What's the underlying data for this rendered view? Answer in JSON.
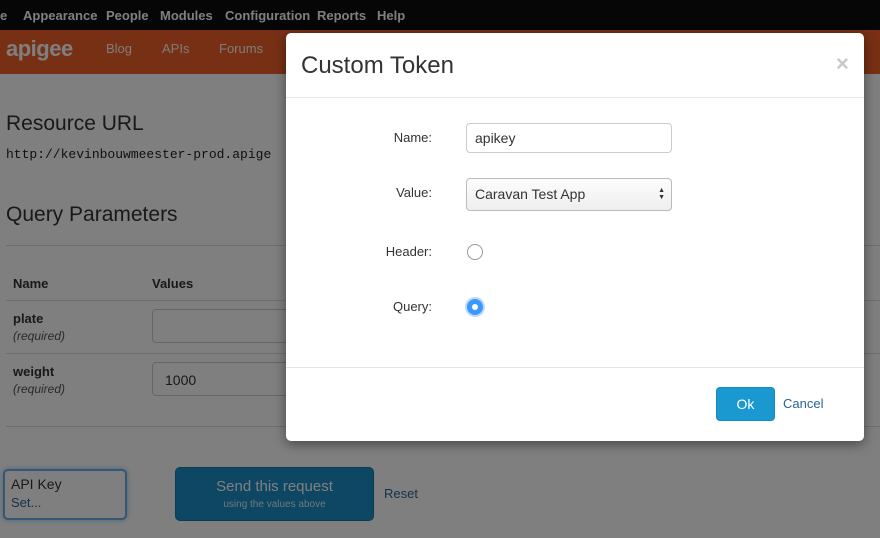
{
  "admin_menu": {
    "items": [
      "e",
      "Appearance",
      "People",
      "Modules",
      "Configuration",
      "Reports",
      "Help"
    ]
  },
  "site_nav": {
    "logo": "apigee",
    "links": [
      "Blog",
      "APIs",
      "Forums"
    ]
  },
  "page": {
    "resource_url_heading": "Resource URL",
    "resource_url": "http://kevinbouwmeester-prod.apige",
    "query_params_heading": "Query Parameters",
    "columns": [
      "Name",
      "Values"
    ],
    "params": [
      {
        "name": "plate",
        "note": "(required)",
        "value": ""
      },
      {
        "name": "weight",
        "note": "(required)",
        "value": "1000"
      }
    ],
    "api_key": {
      "label": "API Key",
      "action": "Set..."
    },
    "send_button": {
      "label": "Send this request",
      "sublabel": "using the values above"
    },
    "reset_label": "Reset"
  },
  "modal": {
    "title": "Custom Token",
    "close_glyph": "×",
    "fields": {
      "name_label": "Name:",
      "name_value": "apikey",
      "value_label": "Value:",
      "value_selected": "Caravan Test App",
      "header_label": "Header:",
      "header_checked": false,
      "query_label": "Query:",
      "query_checked": true
    },
    "ok_label": "Ok",
    "cancel_label": "Cancel"
  },
  "colors": {
    "admin_bar": "#0c0c0c",
    "brand_orange": "#f0612a",
    "primary_blue": "#1a99d1",
    "link_blue": "#2a6496"
  }
}
